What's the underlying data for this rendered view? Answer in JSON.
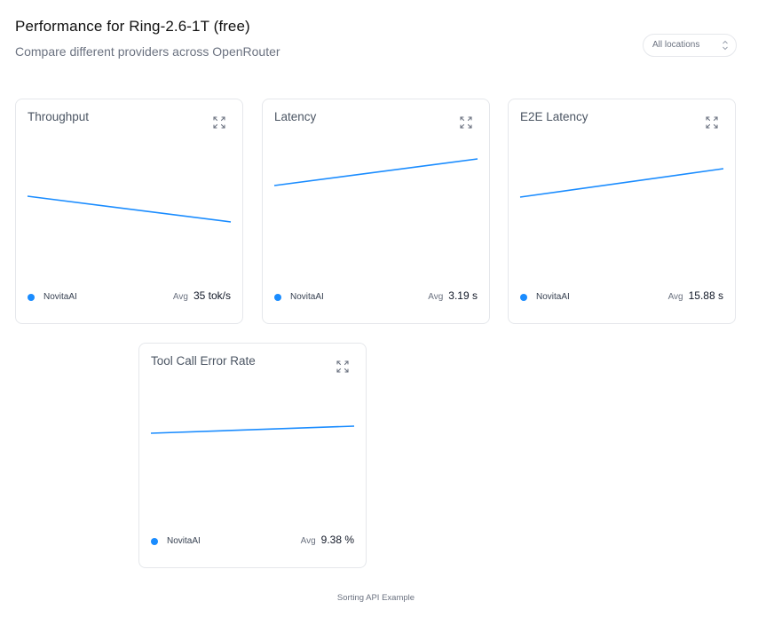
{
  "header": {
    "title": "Performance for Ring-2.6-1T (free)",
    "subtitle": "Compare different providers across OpenRouter"
  },
  "location_select": {
    "value": "All locations"
  },
  "accent_color": "#1a8cff",
  "cards": [
    {
      "title": "Throughput",
      "provider": "NovitaAI",
      "avg_label": "Avg",
      "avg_value": "35 tok/s",
      "icon": "expand-icon"
    },
    {
      "title": "Latency",
      "provider": "NovitaAI",
      "avg_label": "Avg",
      "avg_value": "3.19 s",
      "icon": "expand-icon"
    },
    {
      "title": "E2E Latency",
      "provider": "NovitaAI",
      "avg_label": "Avg",
      "avg_value": "15.88 s",
      "icon": "expand-icon"
    },
    {
      "title": "Tool Call Error Rate",
      "provider": "NovitaAI",
      "avg_label": "Avg",
      "avg_value": "9.38 %",
      "icon": "expand-icon"
    }
  ],
  "footer": {
    "link_text": "Sorting API Example"
  }
}
